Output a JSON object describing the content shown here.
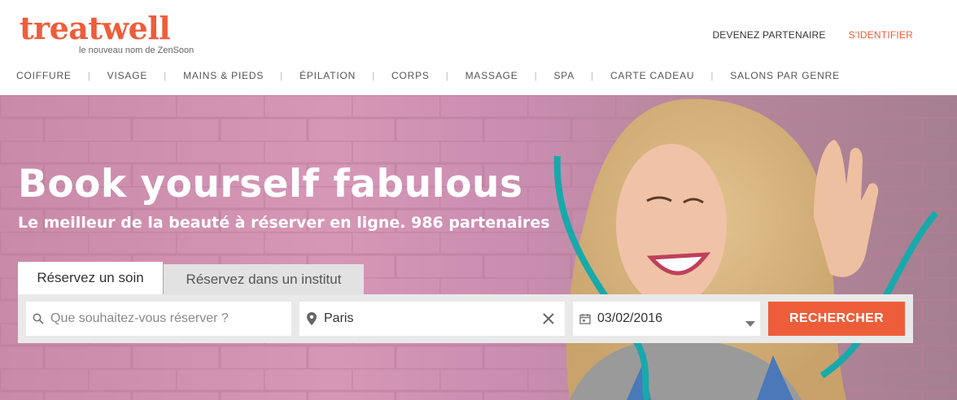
{
  "brand": {
    "logo_text": "treatwell",
    "tagline": "le nouveau nom de ZenSoon",
    "accent_color": "#ee5d3a"
  },
  "top_links": {
    "partner": "DEVENEZ PARTENAIRE",
    "login": "S'IDENTIFIER"
  },
  "nav": {
    "items": [
      "COIFFURE",
      "VISAGE",
      "MAINS & PIEDS",
      "ÉPILATION",
      "CORPS",
      "MASSAGE",
      "SPA",
      "CARTE CADEAU",
      "SALONS PAR GENRE"
    ]
  },
  "hero": {
    "title": "Book yourself fabulous",
    "subtitle": "Le meilleur de la beauté à réserver en ligne. 986 partenaires"
  },
  "search": {
    "tabs": [
      "Réservez un soin",
      "Réservez dans un institut"
    ],
    "treatment_placeholder": "Que souhaitez-vous réserver ?",
    "location_value": "Paris",
    "date_value": "03/02/2016",
    "button_label": "RECHERCHER"
  },
  "icons": {
    "search": "search-icon",
    "location": "map-pin-icon",
    "clear": "close-icon",
    "calendar": "calendar-icon",
    "dropdown": "chevron-down-icon"
  }
}
